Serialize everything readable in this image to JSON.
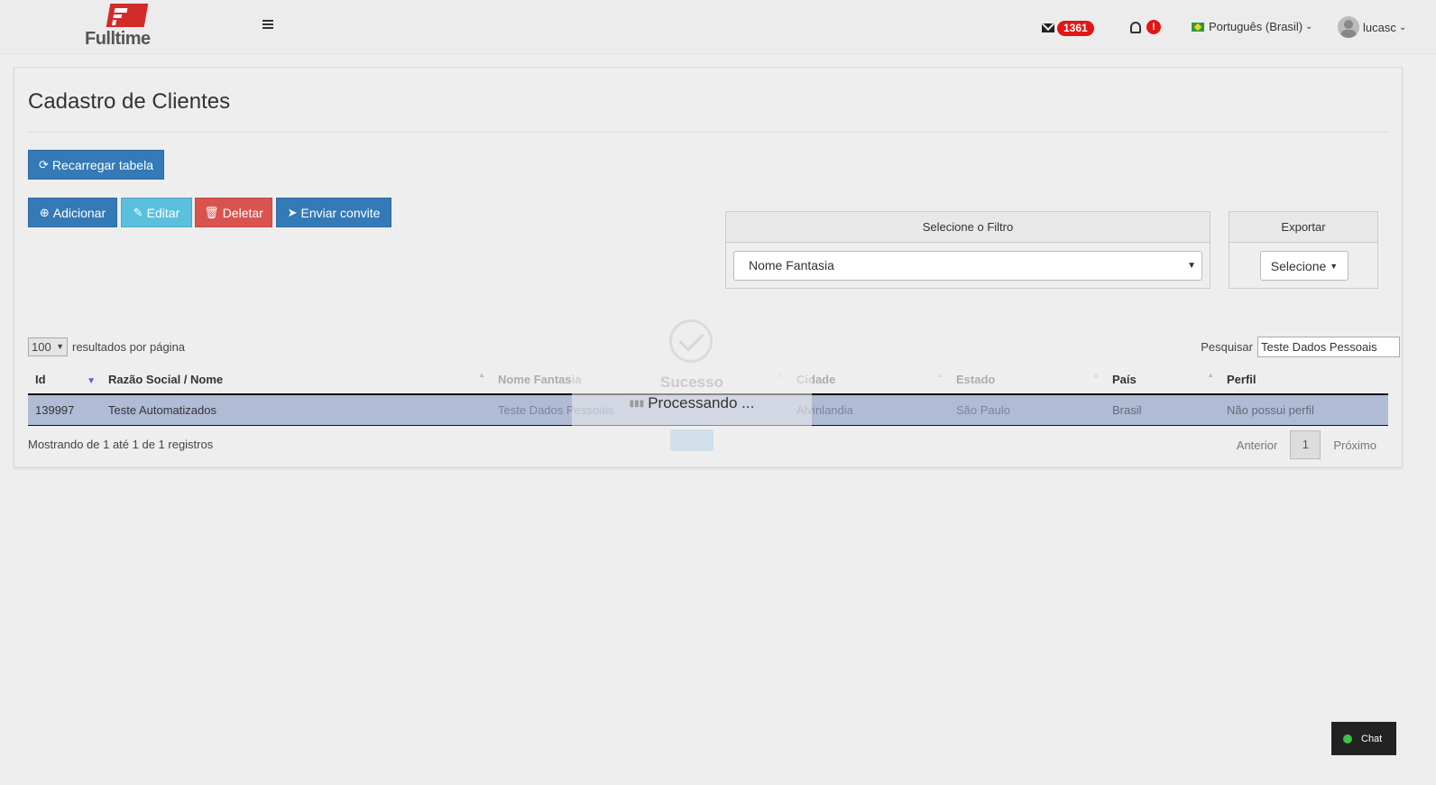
{
  "app": {
    "logo_text": "Fulltime"
  },
  "header": {
    "mail_count": "1361",
    "notification_badge": "!",
    "language": "Português (Brasil)",
    "username": "lucasc"
  },
  "page": {
    "title": "Cadastro de Clientes"
  },
  "toolbar": {
    "reload_label": "Recarregar tabela",
    "add_label": "Adicionar",
    "edit_label": "Editar",
    "delete_label": "Deletar",
    "invite_label": "Enviar convite"
  },
  "filter": {
    "title": "Selecione o Filtro",
    "selected": "Nome Fantasia"
  },
  "export": {
    "title": "Exportar",
    "button": "Selecione"
  },
  "table_controls": {
    "page_length": "100",
    "page_length_suffix": "resultados por página",
    "search_label": "Pesquisar",
    "search_value": "Teste Dados Pessoais"
  },
  "table": {
    "columns": [
      "Id",
      "Razão Social / Nome",
      "Nome Fantasia",
      "Cidade",
      "Estado",
      "País",
      "Perfil"
    ],
    "rows": [
      [
        "139997",
        "Teste Automatizados",
        "Teste Dados Pessoais",
        "Alvinlandia",
        "São Paulo",
        "Brasil",
        "Não possui perfil"
      ]
    ],
    "info": "Mostrando de 1 até 1 de 1 registros"
  },
  "pagination": {
    "prev": "Anterior",
    "current": "1",
    "next": "Próximo"
  },
  "overlay": {
    "title": "Sucesso",
    "processing": "Processando ..."
  },
  "chat": {
    "label": "Chat"
  },
  "colors": {
    "primary": "#337ab7",
    "info": "#5bc0de",
    "danger": "#d9534f",
    "badge": "#e21616",
    "selected_row": "#b0bbd6"
  }
}
